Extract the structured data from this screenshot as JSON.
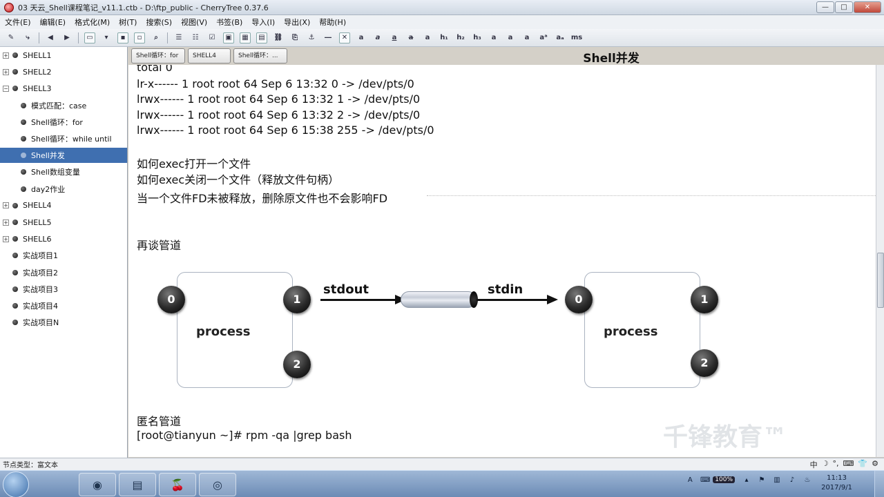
{
  "window": {
    "title": "03 天云_Shell课程笔记_v11.1.ctb - D:\\ftp_public - CherryTree 0.37.6",
    "buttons": [
      "—",
      "□",
      "✕"
    ]
  },
  "menu": [
    "文件(E)",
    "编辑(E)",
    "格式化(M)",
    "树(T)",
    "搜索(S)",
    "视图(V)",
    "书签(B)",
    "导入(I)",
    "导出(X)",
    "帮助(H)"
  ],
  "toolbar_glyphs": [
    "a",
    "a",
    "a",
    "a",
    "a",
    "h₁",
    "h₂",
    "h₃",
    "a",
    "a",
    "a",
    "aᵃ",
    "aₐ",
    "ms"
  ],
  "sidebar": {
    "items": [
      {
        "label": "SHELL1",
        "level": 0,
        "expander": "+"
      },
      {
        "label": "SHELL2",
        "level": 0,
        "expander": "+"
      },
      {
        "label": "SHELL3",
        "level": 0,
        "expander": "−"
      },
      {
        "label": "模式匹配：case",
        "level": 1
      },
      {
        "label": "Shell循环：for",
        "level": 1
      },
      {
        "label": "Shell循环：while until",
        "level": 1
      },
      {
        "label": "Shell并发",
        "level": 1,
        "selected": true
      },
      {
        "label": "Shell数组变量",
        "level": 1
      },
      {
        "label": "day2作业",
        "level": 1
      },
      {
        "label": "SHELL4",
        "level": 0,
        "expander": "+"
      },
      {
        "label": "SHELL5",
        "level": 0,
        "expander": "+"
      },
      {
        "label": "SHELL6",
        "level": 0,
        "expander": "+"
      },
      {
        "label": "实战项目1",
        "level": 0
      },
      {
        "label": "实战项目2",
        "level": 0
      },
      {
        "label": "实战项目3",
        "level": 0
      },
      {
        "label": "实战项目4",
        "level": 0
      },
      {
        "label": "实战项目N",
        "level": 0
      }
    ]
  },
  "tabs": [
    "Shell循环：for",
    "SHELL4",
    "Shell循环：..."
  ],
  "node_title": "Shell并发",
  "content": {
    "lines": [
      "total 0",
      "lr-x------ 1 root root 64 Sep  6 13:32 0 -> /dev/pts/0",
      "lrwx------ 1 root root 64 Sep  6 13:32 1 -> /dev/pts/0",
      "lrwx------ 1 root root 64 Sep  6 13:32 2 -> /dev/pts/0",
      "lrwx------ 1 root root 64 Sep  6 15:38 255 -> /dev/pts/0",
      "如何exec打开一个文件",
      "如何exec关闭一个文件（释放文件句柄）",
      "当一个文件FD未被释放，删除原文件也不会影响FD",
      "再谈管道",
      "匿名管道",
      "[root@tianyun ~]# rpm -qa |grep bash"
    ],
    "diagram": {
      "left_process": "process",
      "right_process": "process",
      "left_fds": [
        "0",
        "1",
        "2"
      ],
      "right_fds": [
        "0",
        "1",
        "2"
      ],
      "stdout_label": "stdout",
      "stdin_label": "stdin"
    }
  },
  "statusbar": {
    "node_type": "节点类型：富文本",
    "ime": [
      "中",
      "☽",
      "°,",
      "⌨",
      "👕",
      "⚙"
    ]
  },
  "watermark": "千锋教育™",
  "taskbar": {
    "zoom": "100%",
    "time": "11:13",
    "date": "2017/9/1"
  }
}
